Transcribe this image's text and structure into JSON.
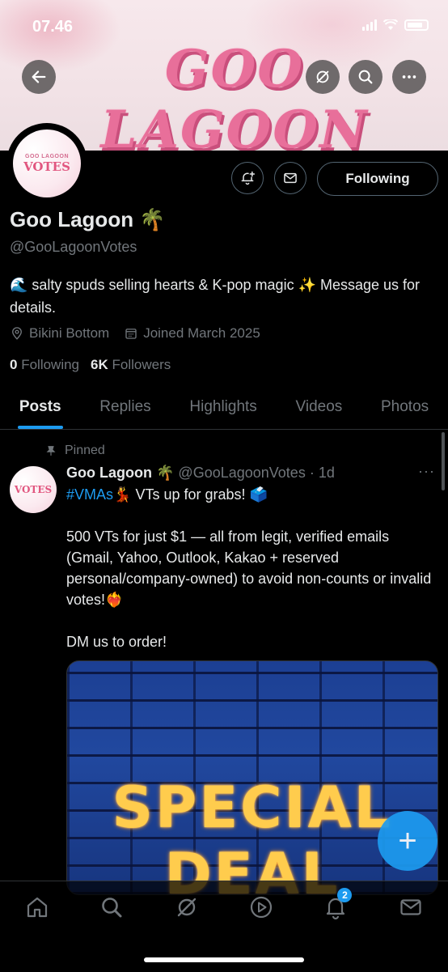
{
  "status_bar": {
    "time": "07.46"
  },
  "banner": {
    "text": "GOO LAGOON"
  },
  "profile": {
    "avatar_top": "GOO LAGOON",
    "avatar_main": "VOTES",
    "name": "Goo Lagoon 🌴",
    "handle": "@GooLagoonVotes",
    "bio": "🌊 salty spuds selling hearts & K-pop magic ✨ Message us for details.",
    "location": "Bikini Bottom",
    "joined": "Joined March 2025",
    "following_count": "0",
    "following_label": "Following",
    "followers_count": "6K",
    "followers_label": "Followers",
    "follow_button": "Following"
  },
  "tabs": [
    {
      "label": "Posts",
      "active": true
    },
    {
      "label": "Replies"
    },
    {
      "label": "Highlights"
    },
    {
      "label": "Videos"
    },
    {
      "label": "Photos"
    }
  ],
  "post": {
    "pinned_label": "Pinned",
    "author_name": "Goo Lagoon 🌴",
    "author_handle": "@GooLagoonVotes · 1d",
    "more": "···",
    "hashtag": "#VMAs💃",
    "line1_rest": " VTs up for grabs! 🗳️",
    "para2": "500 VTs for just $1 — all from legit, verified emails (Gmail, Yahoo, Outlook, Kakao + reserved personal/company-owned) to avoid non-counts or invalid votes!❤️‍🔥",
    "para3": "DM us to order!",
    "media_line1": "SPECIAL",
    "media_line2": "DEAL"
  },
  "fab": {
    "label": "+"
  },
  "bottom_nav": {
    "items": [
      "home-icon",
      "search-icon",
      "grok-icon",
      "video-icon",
      "bell-icon",
      "mail-icon"
    ],
    "notifications_badge": "2"
  },
  "colors": {
    "accent": "#1d9bf0",
    "background": "#000000",
    "banner_pink": "#e86f9a"
  }
}
